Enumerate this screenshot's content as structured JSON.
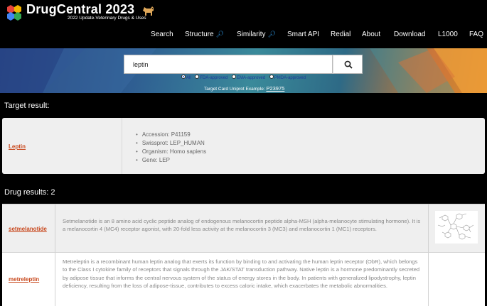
{
  "header": {
    "brand": "DrugCentral 2023",
    "tagline": "2022 Update-Veterinary Drugs & Uses",
    "nav": [
      {
        "label": "Search",
        "icon": ""
      },
      {
        "label": "Structure",
        "icon": "magnifier-icon"
      },
      {
        "label": "Similarity",
        "icon": "magnifier-icon"
      },
      {
        "label": "Smart API",
        "icon": ""
      },
      {
        "label": "Redial",
        "icon": ""
      },
      {
        "label": "About",
        "icon": ""
      },
      {
        "label": "Download",
        "icon": ""
      },
      {
        "label": "L1000",
        "icon": ""
      },
      {
        "label": "FAQ",
        "icon": ""
      }
    ]
  },
  "search": {
    "value": "leptin",
    "filters": [
      {
        "label": "All",
        "selected": true
      },
      {
        "label": "FDA-approved",
        "selected": false
      },
      {
        "label": "EMA-approved",
        "selected": false
      },
      {
        "label": "PMDA-approved",
        "selected": false
      }
    ],
    "example_prefix": "Target Card Uniprot Example:",
    "example_link": "P23975"
  },
  "target_section": {
    "title": "Target result:",
    "name": "Leptin",
    "details": [
      "Accession: P41159",
      "Swissprot: LEP_HUMAN",
      "Organism: Homo sapiens",
      "Gene: LEP"
    ]
  },
  "drug_section": {
    "title": "Drug results: 2",
    "drugs": [
      {
        "name": "setmelanotide",
        "description": "Setmelanotide is an 8 amino acid cyclic peptide analog of endogenous melanocortin peptide alpha-MSH (alpha-melanocyte stimulating hormone). It is a melanocortin 4 (MC4) receptor agonist, with 20-fold less activity at the melanocortin 3 (MC3) and melanocortin 1 (MC1) receptors.",
        "has_structure": true
      },
      {
        "name": "metreleptin",
        "description": "Metreleptin is a recombinant human leptin analog that exerts its function by binding to and activating the human leptin receptor (ObR), which belongs to the Class I cytokine family of receptors that signals through the JAK/STAT transduction pathway. Native leptin is a hormone predominantly secreted by adipose tissue that informs the central nervous system of the status of energy stores in the body. In patients with generalized lipodystrophy, leptin deficiency, resulting from the loss of adipose-tissue, contributes to excess caloric intake, which exacerbates the metabolic abnormalities.",
        "has_structure": false
      }
    ]
  },
  "colors": {
    "link": "#c8481d",
    "nav_icon": "#2a8fd8",
    "card_bg": "#efefef"
  }
}
